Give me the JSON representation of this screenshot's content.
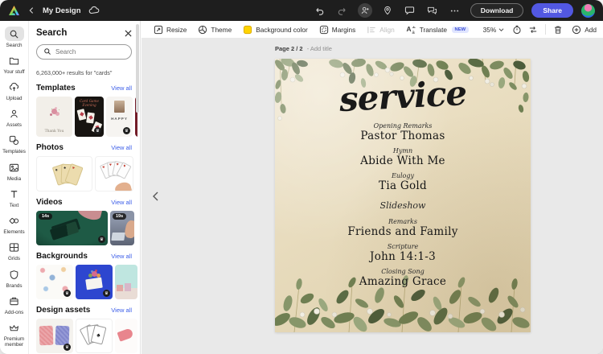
{
  "topbar": {
    "title": "My Design",
    "download_label": "Download",
    "share_label": "Share"
  },
  "toolbar": {
    "resize": "Resize",
    "theme": "Theme",
    "background_color": "Background color",
    "margins": "Margins",
    "align": "Align",
    "translate": "Translate",
    "new_badge": "NEW",
    "zoom_level": "35%",
    "add_label": "Add"
  },
  "sidebar": {
    "items": [
      {
        "label": "Search"
      },
      {
        "label": "Your stuff"
      },
      {
        "label": "Upload"
      },
      {
        "label": "Assets"
      },
      {
        "label": "Templates"
      },
      {
        "label": "Media"
      },
      {
        "label": "Text"
      },
      {
        "label": "Elements"
      },
      {
        "label": "Grids"
      },
      {
        "label": "Brands"
      },
      {
        "label": "Add-ons"
      },
      {
        "label": "Premium member"
      }
    ]
  },
  "search_panel": {
    "title": "Search",
    "placeholder": "Search",
    "results_text": "6,263,000+ results for \"cards\"",
    "sections": [
      {
        "name": "Templates",
        "view_all": "View all"
      },
      {
        "name": "Photos",
        "view_all": "View all"
      },
      {
        "name": "Videos",
        "view_all": "View all"
      },
      {
        "name": "Backgrounds",
        "view_all": "View all"
      },
      {
        "name": "Design assets",
        "view_all": "View all"
      }
    ],
    "templates": {
      "card1_text": "Thank You",
      "card2_text": "Card Game Evening",
      "card3_text": "HAPPY"
    },
    "videos": {
      "video1_duration": "14s",
      "video2_duration": "19s"
    }
  },
  "canvas": {
    "page_label": "Page 2 / 2",
    "page_label_suffix": "- Add title",
    "design": {
      "title": "service",
      "items": [
        {
          "label": "Opening Remarks",
          "value": "Pastor Thomas"
        },
        {
          "label": "Hymn",
          "value": "Abide With Me"
        },
        {
          "label": "Eulogy",
          "value": "Tia Gold"
        },
        {
          "label": "Slideshow",
          "value": ""
        },
        {
          "label": "Remarks",
          "value": "Friends and Family"
        },
        {
          "label": "Scripture",
          "value": "John 14:1-3"
        },
        {
          "label": "Closing Song",
          "value": "Amazing Grace"
        }
      ]
    }
  },
  "icons": {
    "premium_crown": "♛",
    "translate_a": "A",
    "translate_a_small": "a",
    "spade": "♠",
    "heart": "♥",
    "ace": "A"
  },
  "colors": {
    "accent_blue": "#5258e2",
    "link_blue": "#3a5ce8",
    "swatch_yellow": "#ffd400",
    "paper": "#e8dcbe",
    "canvas_bg": "#e9e9e9",
    "topbar_bg": "#1e1e1e"
  }
}
